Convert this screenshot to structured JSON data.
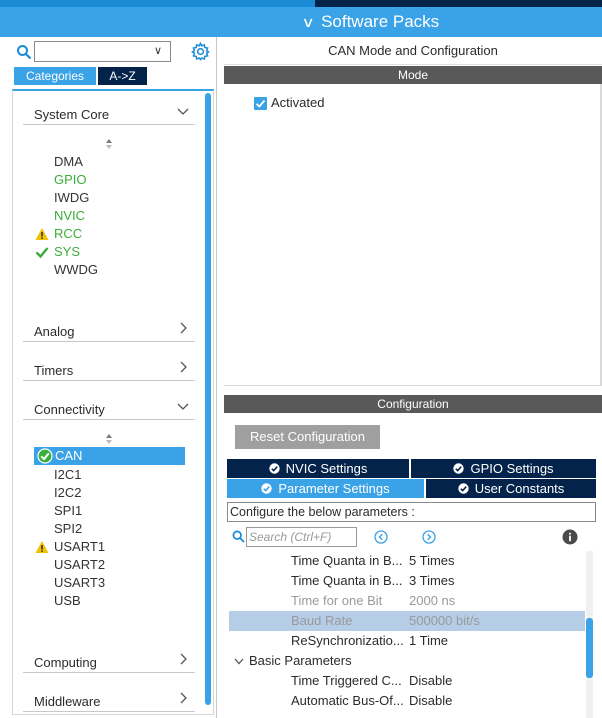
{
  "header": {
    "software_packs_label": "Software Packs"
  },
  "left": {
    "search": {
      "value": ""
    },
    "tabs": {
      "categories": "Categories",
      "atoz": "A->Z"
    },
    "sections": {
      "system_core": "System Core",
      "analog": "Analog",
      "timers": "Timers",
      "connectivity": "Connectivity",
      "computing": "Computing",
      "middleware": "Middleware"
    },
    "system_core_items": [
      "DMA",
      "GPIO",
      "IWDG",
      "NVIC",
      "RCC",
      "SYS",
      "WWDG"
    ],
    "connectivity_items": [
      "CAN",
      "I2C1",
      "I2C2",
      "SPI1",
      "SPI2",
      "USART1",
      "USART2",
      "USART3",
      "USB"
    ]
  },
  "right": {
    "title": "CAN Mode and Configuration",
    "mode_header": "Mode",
    "activated_label": "Activated",
    "config_header": "Configuration",
    "reset_button": "Reset Configuration",
    "tabs": {
      "nvic": "NVIC Settings",
      "gpio": "GPIO Settings",
      "params": "Parameter Settings",
      "user": "User Constants"
    },
    "configure_text": "Configure the below parameters :",
    "search_placeholder": "Search (Ctrl+F)",
    "params": [
      {
        "name": "Time Quanta in B...",
        "value": "5 Times"
      },
      {
        "name": "Time Quanta in B...",
        "value": "3 Times"
      },
      {
        "name": "Time for one Bit",
        "value": "2000 ns"
      },
      {
        "name": "Baud Rate",
        "value": "500000 bit/s"
      },
      {
        "name": "ReSynchronizatio...",
        "value": "1 Time"
      }
    ],
    "basic_group": "Basic Parameters",
    "basic_params": [
      {
        "name": "Time Triggered C...",
        "value": "Disable"
      },
      {
        "name": "Automatic Bus-Of...",
        "value": "Disable"
      }
    ]
  },
  "colors": {
    "accent": "#3aa2e6",
    "navy": "#03234b",
    "ok_green": "#3aae3a",
    "warning": "#f2c200"
  }
}
